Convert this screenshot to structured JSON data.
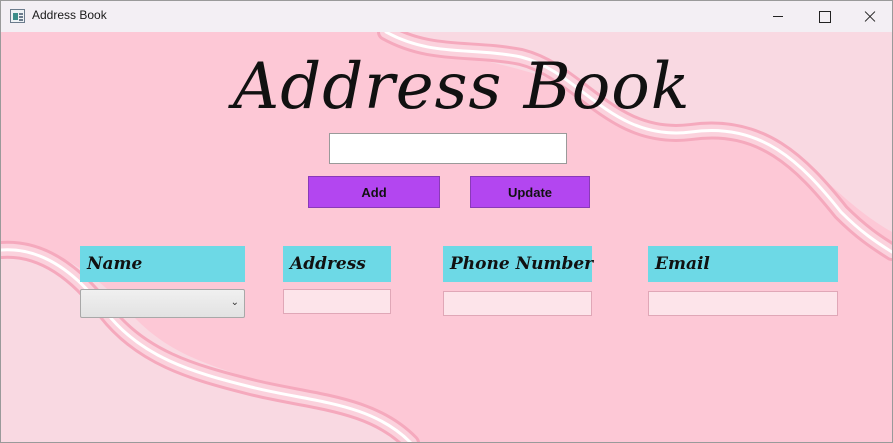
{
  "window": {
    "title": "Address Book",
    "icon": "app-window-icon",
    "controls": [
      "minimize-icon",
      "maximize-icon",
      "close-icon"
    ]
  },
  "app": {
    "heading": "Address Book",
    "search_value": "",
    "buttons": {
      "add": "Add",
      "update": "Update"
    },
    "columns": {
      "name": "Name",
      "address": "Address",
      "phone": "Phone Number",
      "email": "Email"
    },
    "fields": {
      "name_selected": "",
      "address": "",
      "phone": "",
      "email": ""
    }
  },
  "colors": {
    "background": "#fdc8d6",
    "button": "#b346f0",
    "header": "#6dd9e6",
    "field": "#fde4ea"
  }
}
